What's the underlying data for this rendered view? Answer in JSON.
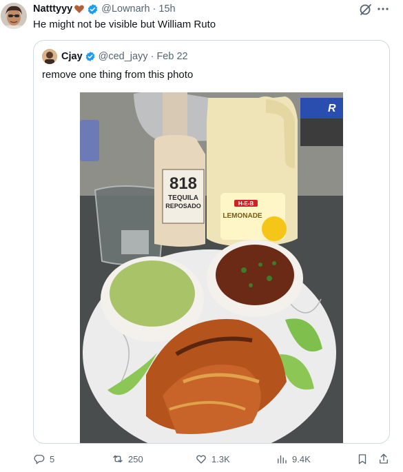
{
  "tweet": {
    "author_name": "Natttyyy",
    "author_handle": "@Lownarh",
    "time": "15h",
    "separator": "·",
    "text": "He might not be visible but William Ruto",
    "icons": [
      "heart-emoji-icon",
      "verified-badge-icon",
      "grok-icon",
      "more-icon"
    ]
  },
  "quoted": {
    "author_name": "Cjay",
    "author_handle": "@ced_jayy",
    "time": "Feb 22",
    "separator": "·",
    "text": "remove one thing from this photo"
  },
  "photo_text": {
    "bottle_label_number": "818",
    "bottle_label_line1": "TEQUILA",
    "bottle_label_line2": "REPOSADO",
    "jug_brand": "H‑E‑B",
    "jug_label": "LEMONADE",
    "foil_letter": "R"
  },
  "actions": {
    "replies": "5",
    "reposts": "250",
    "likes": "1.3K",
    "views": "9.4K"
  },
  "colors": {
    "verified": "#1d9bf0",
    "muted_text": "#536471",
    "border": "#cfd9de",
    "heart": "#b35f3a"
  }
}
